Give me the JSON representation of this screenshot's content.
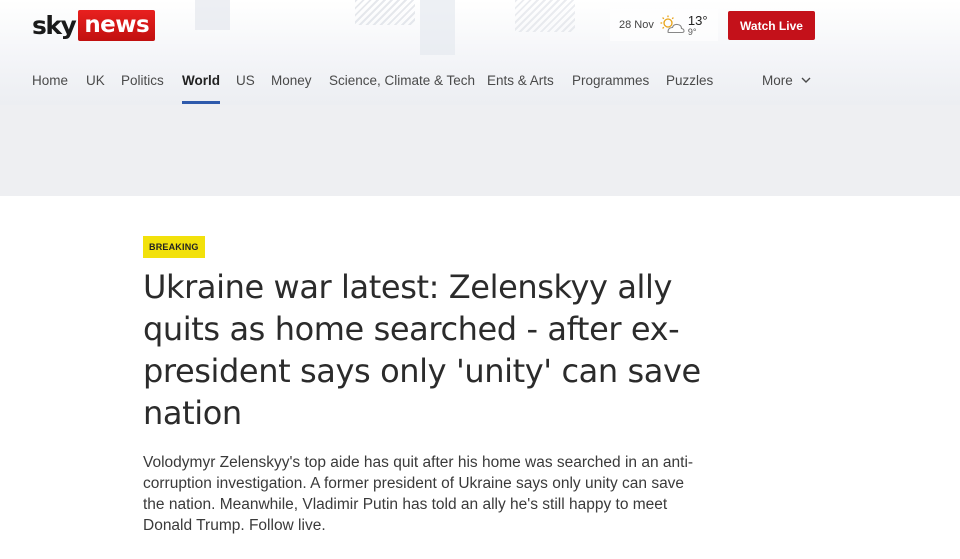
{
  "brand": {
    "logo_sky": "sky",
    "logo_news": "news",
    "accent": "#c4111a"
  },
  "weather": {
    "date": "28 Nov",
    "icon": "sun-cloud-icon",
    "high": "13°",
    "low": "9°"
  },
  "header": {
    "watch_live": "Watch Live"
  },
  "nav": {
    "items": [
      {
        "label": "Home",
        "active": false
      },
      {
        "label": "UK",
        "active": false
      },
      {
        "label": "Politics",
        "active": false
      },
      {
        "label": "World",
        "active": true
      },
      {
        "label": "US",
        "active": false
      },
      {
        "label": "Money",
        "active": false
      },
      {
        "label": "Science, Climate & Tech",
        "active": false
      },
      {
        "label": "Ents & Arts",
        "active": false
      },
      {
        "label": "Programmes",
        "active": false
      },
      {
        "label": "Puzzles",
        "active": false
      }
    ],
    "more_label": "More",
    "active_color": "#2e5aac"
  },
  "article": {
    "badge": "BREAKING",
    "badge_color": "#f2e10b",
    "headline": "Ukraine war latest: Zelenskyy ally quits as home searched - after ex-president says only 'unity' can save nation",
    "standfirst": "Volodymyr Zelenskyy's top aide has quit after his home was searched in an anti-corruption investigation. A former president of Ukraine says only unity can save the nation. Meanwhile, Vladimir Putin has told an ally he's still happy to meet Donald Trump. Follow live."
  }
}
